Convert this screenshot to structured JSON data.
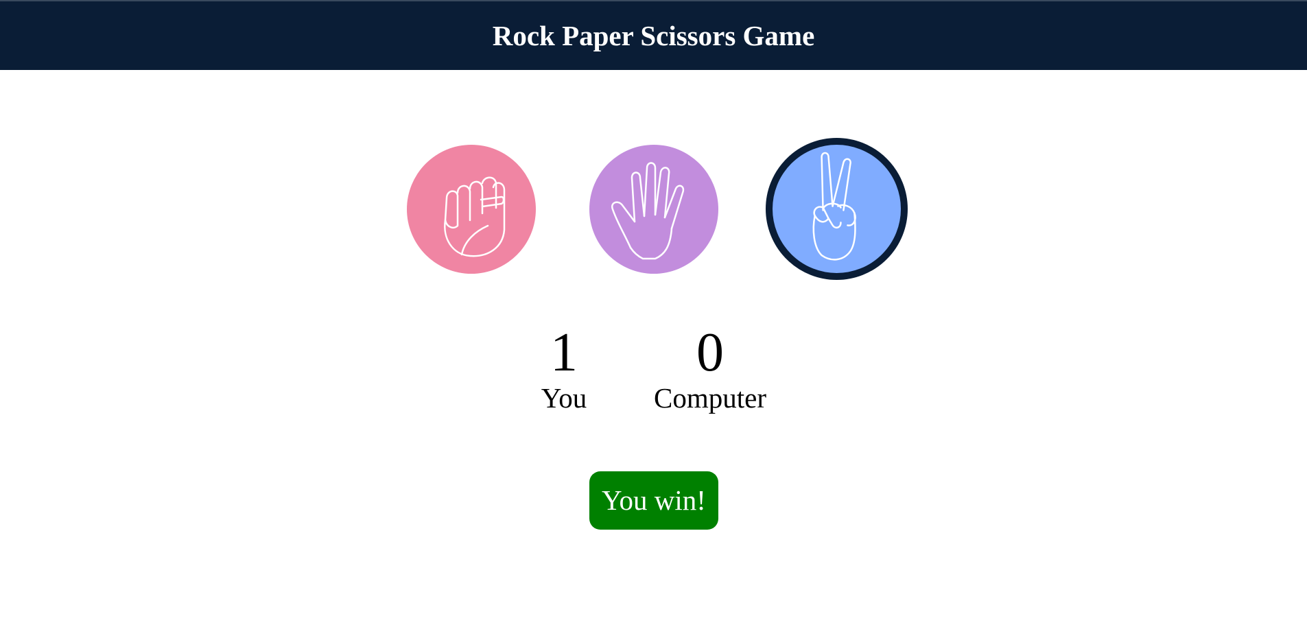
{
  "header": {
    "title": "Rock Paper Scissors Game"
  },
  "choices": [
    {
      "name": "rock",
      "icon": "fist-hand-icon",
      "color": "#f085a3"
    },
    {
      "name": "paper",
      "icon": "open-palm-hand-icon",
      "color": "#c28ddd"
    },
    {
      "name": "scissors",
      "icon": "victory-hand-icon",
      "color": "#80acff",
      "selected": true,
      "ring_color": "#0a1d36"
    }
  ],
  "scoreboard": {
    "user": {
      "score": "1",
      "label": "You"
    },
    "computer": {
      "score": "0",
      "label": "Computer"
    }
  },
  "result": {
    "text": "You win!",
    "color": "#008000"
  },
  "colors": {
    "header_bg": "#0a1d36",
    "page_bg": "#ffffff"
  }
}
